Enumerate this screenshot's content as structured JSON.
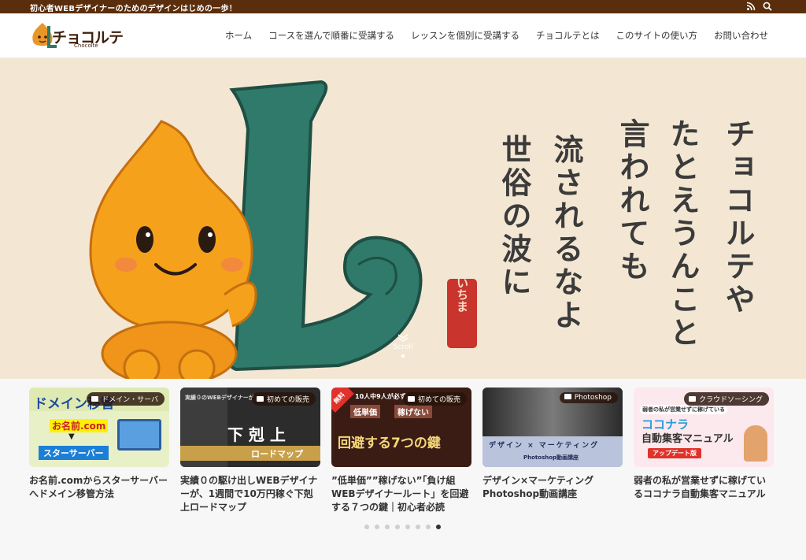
{
  "topbar": {
    "tagline": "初心者WEBデザイナーのためのデザインはじめの一歩！"
  },
  "logo": {
    "text": "チョコルテ",
    "sub": "Chocolte"
  },
  "nav": [
    {
      "label": "ホーム"
    },
    {
      "label": "コースを選んで順番に受講する"
    },
    {
      "label": "レッスンを個別に受講する"
    },
    {
      "label": "チョコルテとは"
    },
    {
      "label": "このサイトの使い方"
    },
    {
      "label": "お問い合わせ"
    }
  ],
  "hero": {
    "poem": [
      "チョコルテや",
      "たとえうんこと",
      "言われても",
      "流されるなよ",
      "世俗の波に"
    ],
    "seal": "いちま",
    "scroll_label": "Scroll"
  },
  "cards": [
    {
      "category": "ドメイン・サーバ",
      "title": "お名前.comからスターサーバーへドメイン移管方法",
      "thumb": {
        "line1": "ドメイン移管",
        "line2": "お名前.com",
        "line3": "スターサーバー"
      }
    },
    {
      "category": "初めての販売",
      "title": "実績０の駆け出しWEBデザイナーが、1週間で10万円稼ぐ下剋上ロードマップ",
      "thumb": {
        "line1": "実績０のWEBデザイナーが",
        "line2": "下 剋 上",
        "line3": "ロードマップ"
      }
    },
    {
      "category": "初めての販売",
      "title": "”低単価””稼げない”「負け組WEBデザイナールート」を回避する７つの鍵｜初心者必読",
      "thumb": {
        "badge": "無料",
        "line1": "10人中9人が必ず",
        "line2a": "低単価",
        "line2b": "稼げない",
        "line3": "回避する7つの鍵"
      }
    },
    {
      "category": "Photoshop",
      "title": "デザイン×マーケティングPhotoshop動画講座",
      "thumb": {
        "line1": "デザイン × マーケティング",
        "line2": "Photoshop動画講座"
      }
    },
    {
      "category": "クラウドソーシング",
      "title": "弱者の私が営業せずに稼げているココナラ自動集客マニュアル",
      "thumb": {
        "line1": "弱者の私が営業せずに稼げている",
        "line2": "ココナラ",
        "line3": "自動集客マニュアル",
        "badge": "アップデート版"
      }
    }
  ],
  "pagination": {
    "count": 8,
    "active": 7
  },
  "colors": {
    "topbar": "#5a2e0c",
    "hero_bg": "#f3e7d3",
    "letter_green": "#2f7a6a",
    "mascot_orange": "#f5a11c"
  }
}
